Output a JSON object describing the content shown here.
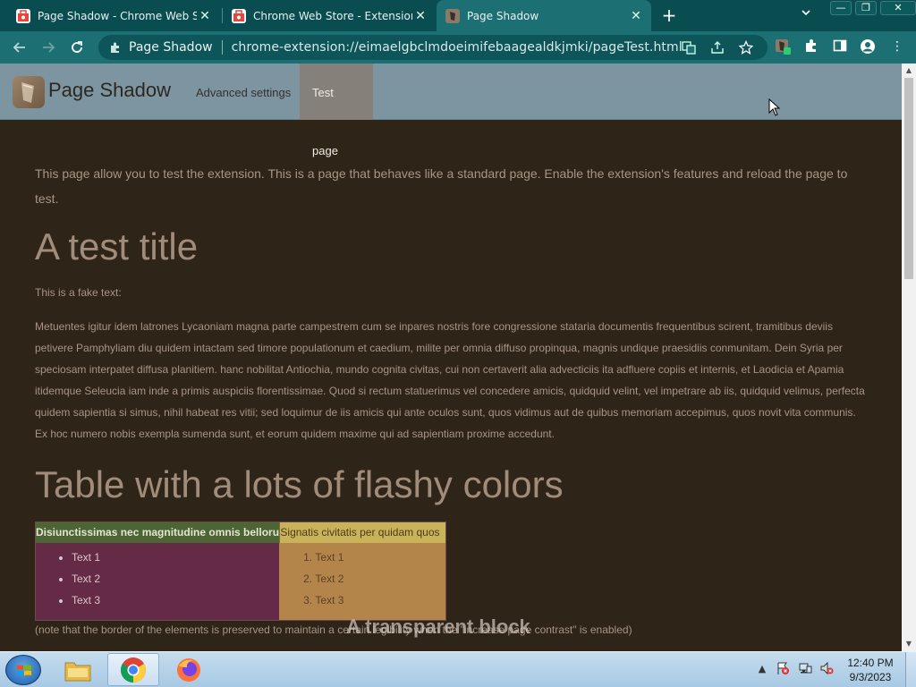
{
  "browser": {
    "tabs": [
      {
        "title": "Page Shadow - Chrome Web Store",
        "active": false
      },
      {
        "title": "Chrome Web Store - Extensions",
        "active": false
      },
      {
        "title": "Page Shadow",
        "active": true
      }
    ],
    "omnibox": {
      "site_name": "Page Shadow",
      "url": "chrome-extension://eimaelgbclmdoeimifebaagealdkjmki/pageTest.html"
    }
  },
  "page": {
    "brand": "Page Shadow",
    "nav": [
      {
        "label": "Advanced settings",
        "active": false
      },
      {
        "label": "Test page",
        "active": true
      }
    ],
    "intro": "This page allow you to test the extension. This is a page that behaves like a standard page. Enable the extension's features and reload the page to test.",
    "title1": "A test title",
    "fake_text_label": "This is a fake text:",
    "lorem": "Metuentes igitur idem latrones Lycaoniam magna parte campestrem cum se inpares nostris fore congressione stataria documentis frequentibus scirent, tramitibus deviis petivere Pamphyliam diu quidem intactam sed timore populationum et caedium, milite per omnia diffuso propinqua, magnis undique praesidiis conmunitam. Dein Syria per speciosam interpatet diffusa planitiem. hanc nobilitat Antiochia, mundo cognita civitas, cui non certaverit alia advecticiis ita adfluere copiis et internis, et Laodicia et Apamia itidemque Seleucia iam inde a primis auspiciis florentissimae. Quod si rectum statuerimus vel concedere amicis, quidquid velint, vel impetrare ab iis, quidquid velimus, perfecta quidem sapientia si simus, nihil habeat res vitii; sed loquimur de iis amicis qui ante oculos sunt, quos vidimus aut de quibus memoriam accepimus, quos novit vita communis. Ex hoc numero nobis exempla sumenda sunt, et eorum quidem maxime qui ad sapientiam proxime accedunt.",
    "title2": "Table with a lots of flashy colors",
    "table": {
      "headers": [
        "Disiunctissimas nec magnitudine omnis bellorum",
        "Signatis civitatis per quidam quos"
      ],
      "list_ul": [
        "Text 1",
        "Text 2",
        "Text 3"
      ],
      "list_ol": [
        "Text 1",
        "Text 2",
        "Text 3"
      ]
    },
    "note": "(note that the border of the elements is preserved to maintain a certain legibility when the \"increase page contrast\" is enabled)",
    "transparent_block": "A transparent block"
  },
  "taskbar": {
    "time": "12:40 PM",
    "date": "9/3/2023"
  },
  "colors": {
    "tab_strip": "#0a4d50",
    "toolbar": "#1c7074",
    "page_bg": "#2f2418",
    "navbar": "#7c95a1"
  }
}
